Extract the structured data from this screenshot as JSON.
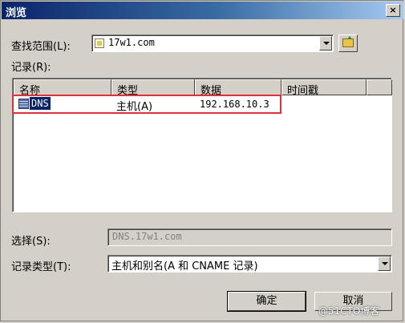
{
  "window": {
    "title": "浏览",
    "close_label": "×"
  },
  "lookin": {
    "label": "查找范围(L):",
    "value": "17w1.com"
  },
  "records_label": "记录(R):",
  "columns": [
    "名称",
    "类型",
    "数据",
    "时间戳"
  ],
  "rows": [
    {
      "name": "DNS",
      "type": "主机(A)",
      "data": "192.168.10.3",
      "timestamp": ""
    }
  ],
  "select": {
    "label": "选择(S):",
    "value": "DNS.17w1.com"
  },
  "record_type": {
    "label": "记录类型(T):",
    "value": "主机和别名(A 和 CNAME 记录)"
  },
  "buttons": {
    "ok": "确定",
    "cancel": "取消"
  },
  "watermark": "@51CTO博客",
  "colors": {
    "title_start": "#0a246a",
    "title_end": "#a6caf0",
    "selection": "#0a246a",
    "highlight": "#e0303a"
  }
}
